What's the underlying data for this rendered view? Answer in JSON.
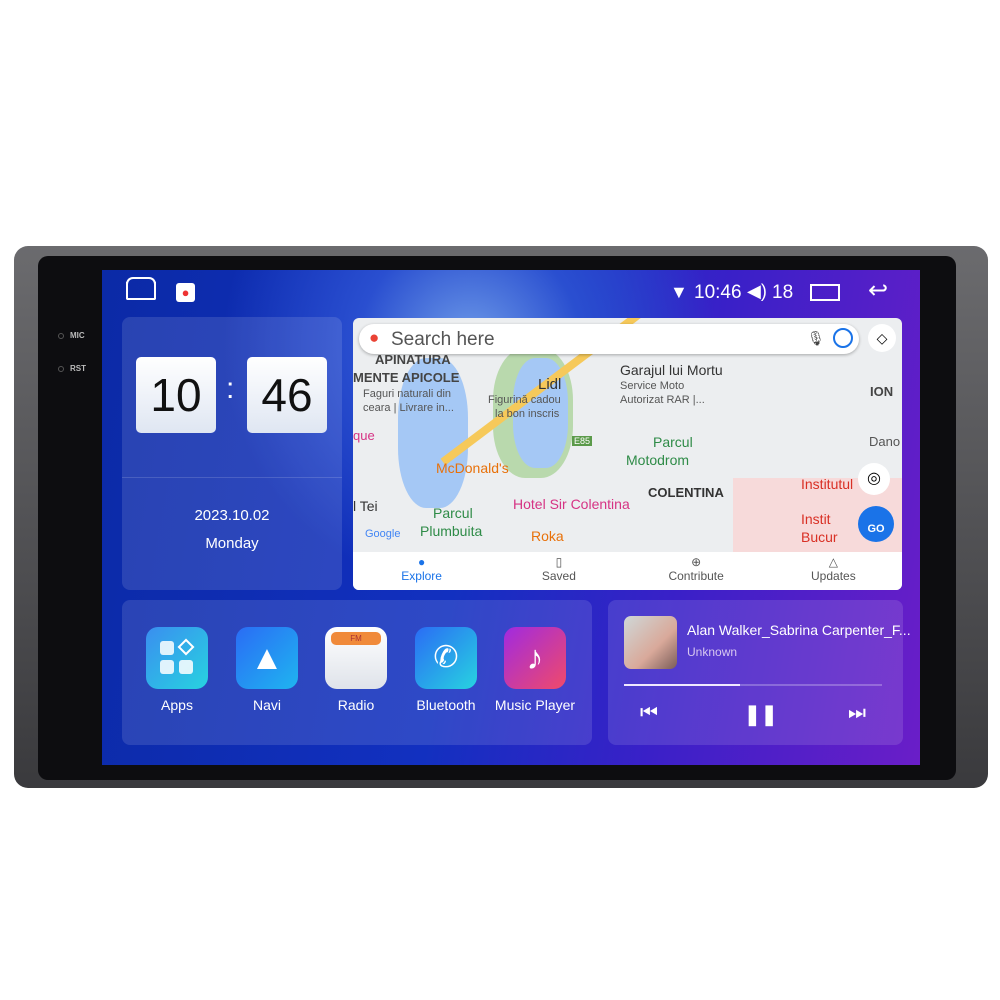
{
  "hardware": {
    "mic_label": "MIC",
    "rst_label": "RST"
  },
  "status_bar": {
    "time": "10:46",
    "volume": "18",
    "icons": [
      "home-icon",
      "google-maps-icon",
      "wifi-icon",
      "volume-icon",
      "recent-apps-icon",
      "back-icon"
    ]
  },
  "clock": {
    "hours": "10",
    "minutes": "46",
    "separator": ":",
    "date": "2023.10.02",
    "weekday": "Monday"
  },
  "maps": {
    "search_placeholder": "Search here",
    "labels": [
      "APINATURA",
      "MENTE APICOLE",
      "Faguri naturali din",
      "ceara | Livrare in...",
      "Lidl",
      "Figurină cadou",
      "la bon inscris",
      "Garajul lui Mortu",
      "Service Moto",
      "Autorizat RAR |...",
      "ION",
      "que",
      "McDonald's",
      "Parcul",
      "Motodrom",
      "Dano",
      "COLENTINA",
      "Hotel Sir Colentina",
      "Institutul",
      "l Tei",
      "Parcul",
      "Plumbuita",
      "Roka",
      "Instit",
      "Bucur",
      "Google",
      "E85",
      "GO"
    ],
    "nav": [
      {
        "label": "Explore",
        "icon": "pin-icon",
        "active": true
      },
      {
        "label": "Saved",
        "icon": "bookmark-icon"
      },
      {
        "label": "Contribute",
        "icon": "plus-circle-icon"
      },
      {
        "label": "Updates",
        "icon": "bell-icon"
      }
    ]
  },
  "apps": [
    {
      "label": "Apps",
      "icon": "apps-grid-icon"
    },
    {
      "label": "Navi",
      "icon": "navigation-arrow-icon"
    },
    {
      "label": "Radio",
      "icon": "radio-icon",
      "badge": "FM"
    },
    {
      "label": "Bluetooth",
      "icon": "bluetooth-phone-icon"
    },
    {
      "label": "Music Player",
      "icon": "music-note-icon"
    }
  ],
  "music": {
    "title": "Alan Walker_Sabrina Carpenter_F...",
    "artist": "Unknown",
    "progress_percent": 45
  },
  "colors": {
    "accent_blue": "#1a73e8",
    "maps_red": "#d93025",
    "screen_blue": "#1230c0",
    "screen_purple": "#6a1ec8"
  }
}
